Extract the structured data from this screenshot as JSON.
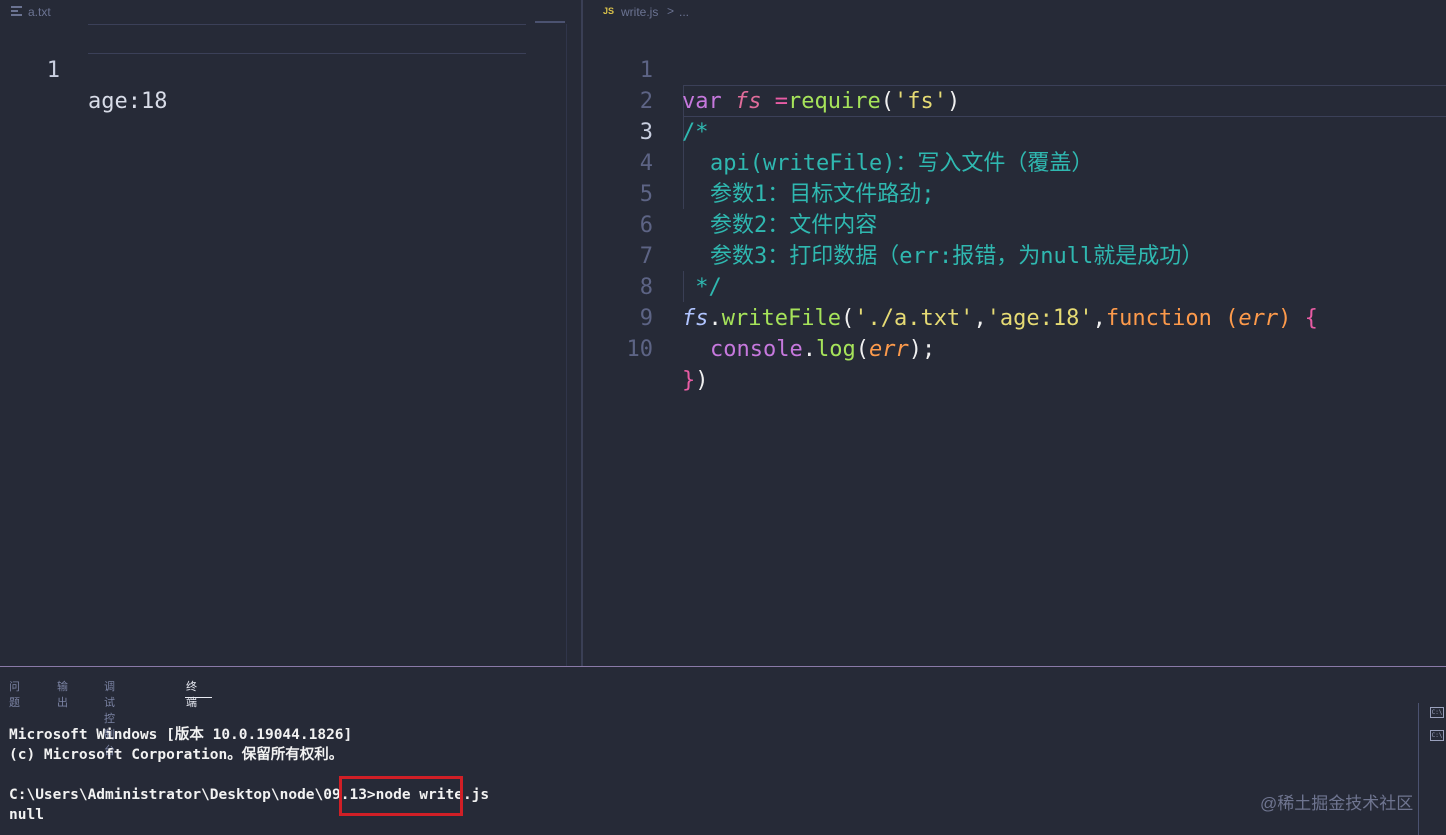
{
  "left_editor": {
    "tab_name": "a.txt",
    "lines": [
      {
        "num": "1",
        "text": "age:18"
      }
    ]
  },
  "right_editor": {
    "tab_name": "write.js",
    "tab_icon_text": "JS",
    "breadcrumb_sep": ">",
    "breadcrumb_more": "...",
    "line_numbers": [
      "1",
      "2",
      "3",
      "4",
      "5",
      "6",
      "7",
      "8",
      "9",
      "10"
    ],
    "active_line": "3",
    "code": {
      "l1": {
        "kw": "var",
        "var": "fs",
        "op": "=",
        "fn": "require",
        "p1": "(",
        "str": "'fs'",
        "p2": ")"
      },
      "l2": "/*",
      "l3": "api(writeFile)：写入文件（覆盖）",
      "l4": "参数1：目标文件路劲;",
      "l5": "参数2：文件内容",
      "l6": "参数3：打印数据（err:报错，为null就是成功）",
      "l7": " */",
      "l8": {
        "obj": "fs",
        "dot": ".",
        "method": "writeFile",
        "p1": "(",
        "s1": "'./a.txt'",
        "c1": ",",
        "s2": "'age:18'",
        "c2": ",",
        "fnkw": "function",
        "sp": " ",
        "pp1": "(",
        "param": "err",
        "pp2": ")",
        "br": " {"
      },
      "l9": {
        "obj": "console",
        "dot": ".",
        "method": "log",
        "p1": "(",
        "arg": "err",
        "p2": ");"
      },
      "l10": {
        "b": "}",
        "p": ")"
      }
    }
  },
  "panel": {
    "tabs": [
      "问题",
      "输出",
      "调试控制台",
      "终端"
    ],
    "active_tab": "终端",
    "terminal": {
      "line1": "Microsoft Windows [版本 10.0.19044.1826]",
      "line2": "(c) Microsoft Corporation。保留所有权利。",
      "prompt": "C:\\Users\\Administrator\\Desktop\\node\\09.13>",
      "command": "node write.js",
      "output": "null"
    },
    "right_icons": [
      "terminal-icon",
      "terminal-icon"
    ],
    "icon_text": "C:\\"
  },
  "watermark": "@稀土掘金技术社区",
  "colors": {
    "background": "#262a37",
    "highlight_box": "#d01f26",
    "comment": "#2fb8b0",
    "string": "#e6db74"
  }
}
